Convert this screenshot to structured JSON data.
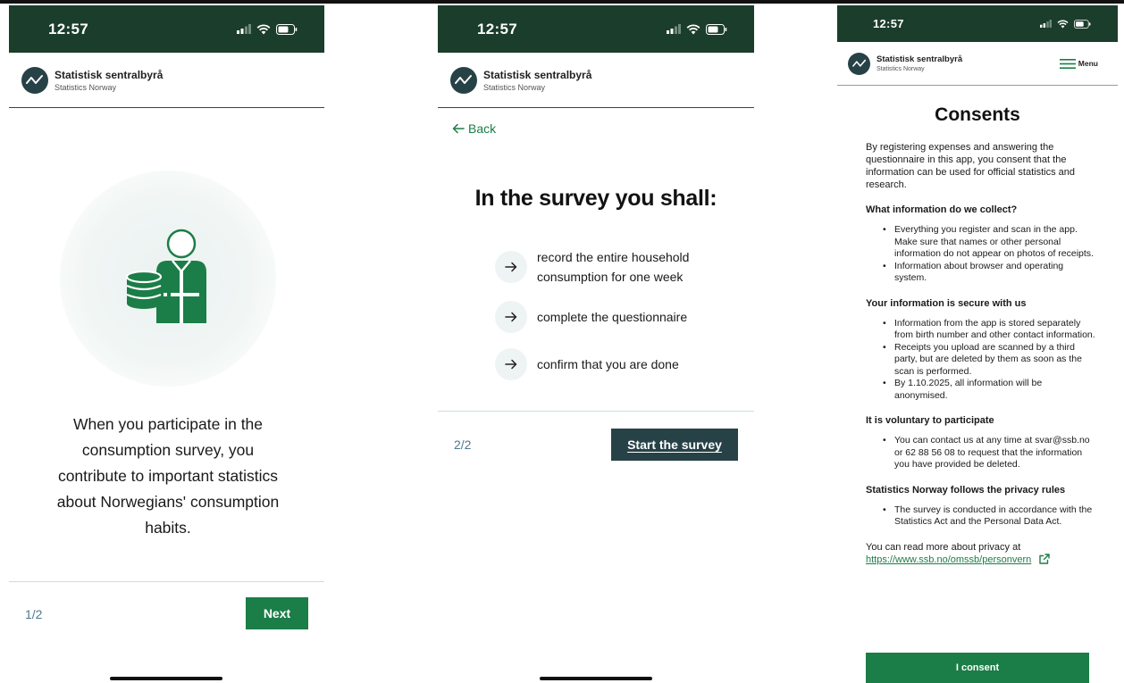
{
  "status_bar": {
    "time": "12:57"
  },
  "brand": {
    "name": "Statistisk sentralbyrå",
    "subtitle": "Statistics Norway"
  },
  "screen1": {
    "intro": "When you participate in the consumption survey, you contribute to important statistics about Norwegians' consumption habits.",
    "pager": "1/2",
    "next_label": "Next"
  },
  "screen2": {
    "back_label": "Back",
    "heading": "In the survey you shall:",
    "steps": [
      "record the entire household consumption for one week",
      "complete the questionnaire",
      "confirm that you are done"
    ],
    "pager": "2/2",
    "start_label": "Start the survey"
  },
  "screen3": {
    "menu_label": "Menu",
    "heading": "Consents",
    "intro": "By registering expenses and answering the questionnaire in this app, you consent that the information can be used for official statistics and research.",
    "sections": [
      {
        "title": "What information do we collect?",
        "items": [
          "Everything you register and scan in the app. Make sure that names or other personal information do not appear on photos of receipts.",
          "Information about browser and operating system."
        ]
      },
      {
        "title": "Your information is secure with us",
        "items": [
          "Information from the app is stored separately from birth number and other contact information.",
          "Receipts you upload are scanned by a third party, but are deleted by them as soon as the scan is performed.",
          "By 1.10.2025, all information will be anonymised."
        ]
      },
      {
        "title": "It is voluntary to participate",
        "items": [
          "You can contact us at any time at svar@ssb.no or 62 88 56 08 to request that the information you have provided be deleted."
        ]
      },
      {
        "title": "Statistics Norway follows the privacy rules",
        "items": [
          "The survey is conducted in accordance with the Statistics Act and the Personal Data Act."
        ]
      }
    ],
    "read_more": "You can read more about privacy at",
    "privacy_url": "https://www.ssb.no/omssb/personvern",
    "consent_label": "I consent"
  },
  "colors": {
    "status_bg": "#1b3d2b",
    "primary_green": "#1b7d47",
    "dark_teal": "#274247"
  }
}
